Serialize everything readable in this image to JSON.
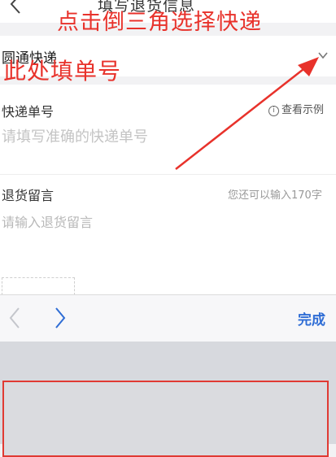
{
  "header": {
    "title": "填写退货信息"
  },
  "form": {
    "courier": {
      "value": "圆通快递"
    },
    "tracking": {
      "label": "快递单号",
      "example_link": "查看示例",
      "placeholder": "请填写准确的快递单号"
    },
    "message": {
      "label": "退货留言",
      "char_hint": "您还可以输入170字",
      "placeholder": "请输入退货留言"
    }
  },
  "keyboard_toolbar": {
    "done_label": "完成"
  },
  "annotations": {
    "courier_hint": "点击倒三角选择快递",
    "tracking_hint": "此处填单号",
    "color": "#e8322b"
  },
  "colors": {
    "accent": "#2f6dd5",
    "background": "#f2f2f4"
  }
}
